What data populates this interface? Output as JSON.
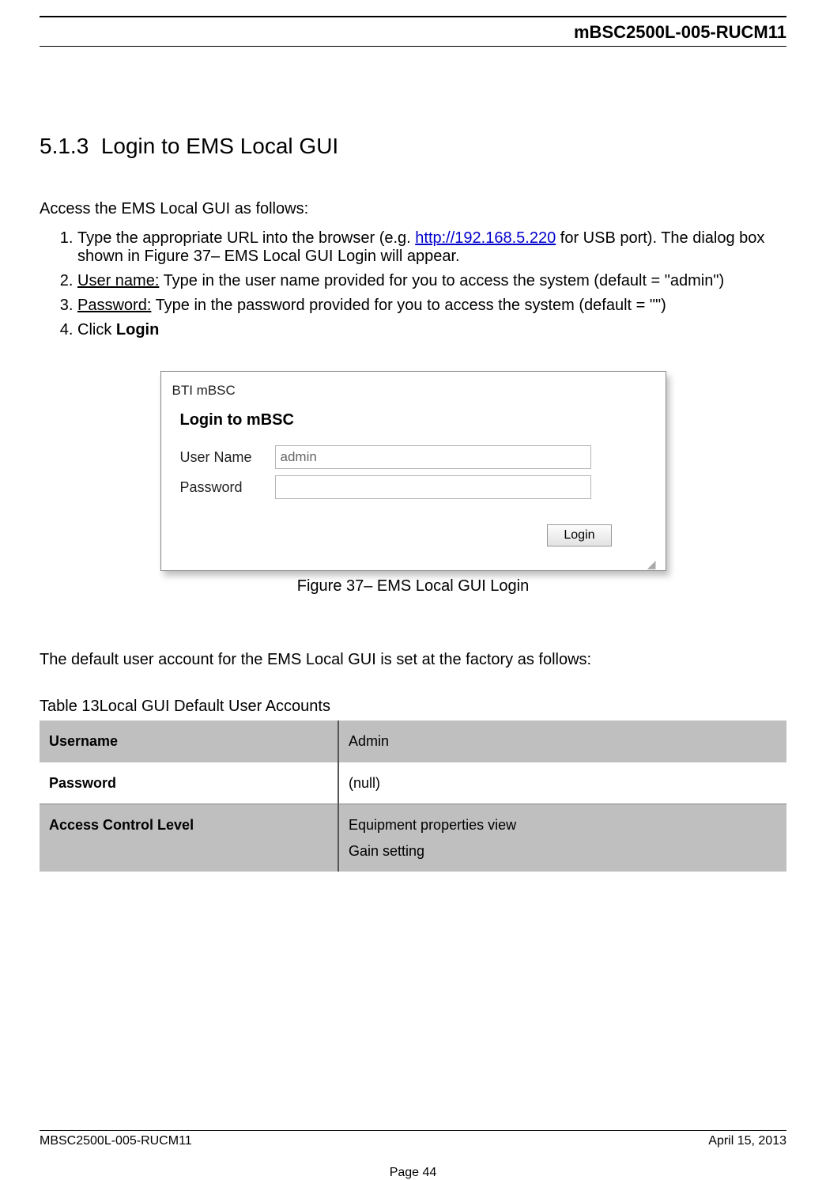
{
  "header": {
    "doc_code": "mBSC2500L-005-RUCM11"
  },
  "section": {
    "number": "5.1.3",
    "title": "Login to EMS Local GUI"
  },
  "intro": "Access the EMS Local GUI as follows:",
  "steps": {
    "s1_a": "Type the appropriate URL into the browser (e.g. ",
    "s1_link": "http://192.168.5.220",
    "s1_b": " for USB port). The dialog box shown in Figure 37– EMS Local GUI Login will appear.",
    "s2_label": "User name:",
    "s2_rest": " Type in the user name provided for you to access the system (default = \"admin\")",
    "s3_label": "Password:",
    "s3_rest": " Type in the password provided for you to access the system (default = \"\")",
    "s4_a": "Click ",
    "s4_bold": "Login"
  },
  "dialog": {
    "window_title": "BTI mBSC",
    "heading": "Login to mBSC",
    "username_label": "User Name",
    "username_value": "admin",
    "password_label": "Password",
    "password_value": "",
    "login_button": "Login"
  },
  "figure_caption": "Figure 37– EMS Local GUI Login",
  "para_default": "The default user account for the EMS Local GUI is set at the factory as follows:",
  "table": {
    "caption": "Table 13Local GUI Default User Accounts",
    "rows": {
      "username_label": "Username",
      "username_value": "Admin",
      "password_label": "Password",
      "password_value": "(null)",
      "acl_label": "Access Control Level",
      "acl_line1": "Equipment properties view",
      "acl_line2": "Gain setting"
    }
  },
  "footer": {
    "left": "MBSC2500L-005-RUCM11",
    "right": "April 15, 2013",
    "page": "Page 44"
  }
}
